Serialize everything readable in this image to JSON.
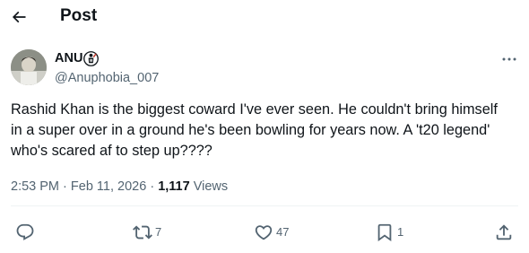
{
  "header": {
    "title": "Post",
    "back_icon": "back-arrow-icon"
  },
  "author": {
    "display_name": "ANU",
    "handle": "@Anuphobia_007",
    "name_emoji": "cricket-batsman-emoji"
  },
  "tweet": {
    "text": "Rashid Khan is the biggest coward I've ever seen. He couldn't bring himself in a super over in a ground he's been bowling for years now. A 't20 legend' who's scared af to step up????"
  },
  "meta": {
    "time": "2:53 PM",
    "separator": "·",
    "date": "Feb 11, 2026",
    "views_count": "1,117",
    "views_label": "Views"
  },
  "actions": {
    "reply": {
      "icon": "reply-icon",
      "count": ""
    },
    "repost": {
      "icon": "repost-icon",
      "count": "7"
    },
    "like": {
      "icon": "heart-icon",
      "count": "47"
    },
    "bookmark": {
      "icon": "bookmark-icon",
      "count": "1"
    },
    "share": {
      "icon": "share-icon",
      "count": ""
    }
  },
  "colors": {
    "text": "#0f1419",
    "secondary": "#536471",
    "divider": "#eff3f4",
    "background": "#ffffff"
  }
}
